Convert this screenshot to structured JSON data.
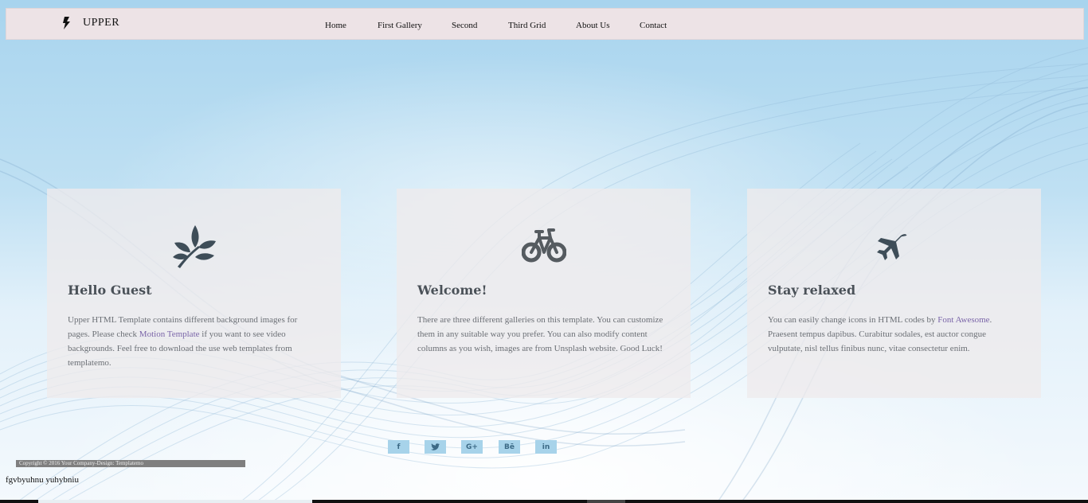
{
  "brand": {
    "name": "UPPER",
    "icon": "bolt-icon"
  },
  "nav": [
    "Home",
    "First Gallery",
    "Second",
    "Third Grid",
    "About Us",
    "Contact"
  ],
  "cards": [
    {
      "icon": "leaf-icon",
      "title": "Hello Guest",
      "text_before": "Upper HTML Template contains different background images for pages. Please check ",
      "link": "Motion Template",
      "text_after": " if you want to see video backgrounds. Feel free to download the use web templates from templatemo."
    },
    {
      "icon": "bicycle-icon",
      "title": "Welcome!",
      "text": "There are three different galleries on this template. You can customize them in any suitable way you prefer. You can also modify content columns as you wish, images are from Unsplash website. Good Luck!"
    },
    {
      "icon": "plane-icon",
      "title": "Stay relaxed",
      "text_before": "You can easily change icons in HTML codes by ",
      "link": "Font Awesome",
      "text_after": ". Praesent tempus dapibus. Curabitur sodales, est auctor congue vulputate, nisl tellus finibus nunc, vitae consectetur enim."
    }
  ],
  "social": [
    {
      "label": "f",
      "icon": "facebook-icon"
    },
    {
      "label": "♥",
      "icon": "twitter-icon"
    },
    {
      "label": "G+",
      "icon": "google-plus-icon"
    },
    {
      "label": "Bē",
      "icon": "behance-icon"
    },
    {
      "label": "in",
      "icon": "linkedin-icon"
    }
  ],
  "footer": {
    "copyright": "Copyright © 2016 Your Company-Design: Templatemo",
    "extra": "fgvbyuhnu yuhybniu"
  },
  "colors": {
    "nav_bg": "#ede3e6",
    "card_bg": "#eeeaec",
    "link": "#7a65a8",
    "social_bg": "#a7d3ea"
  }
}
